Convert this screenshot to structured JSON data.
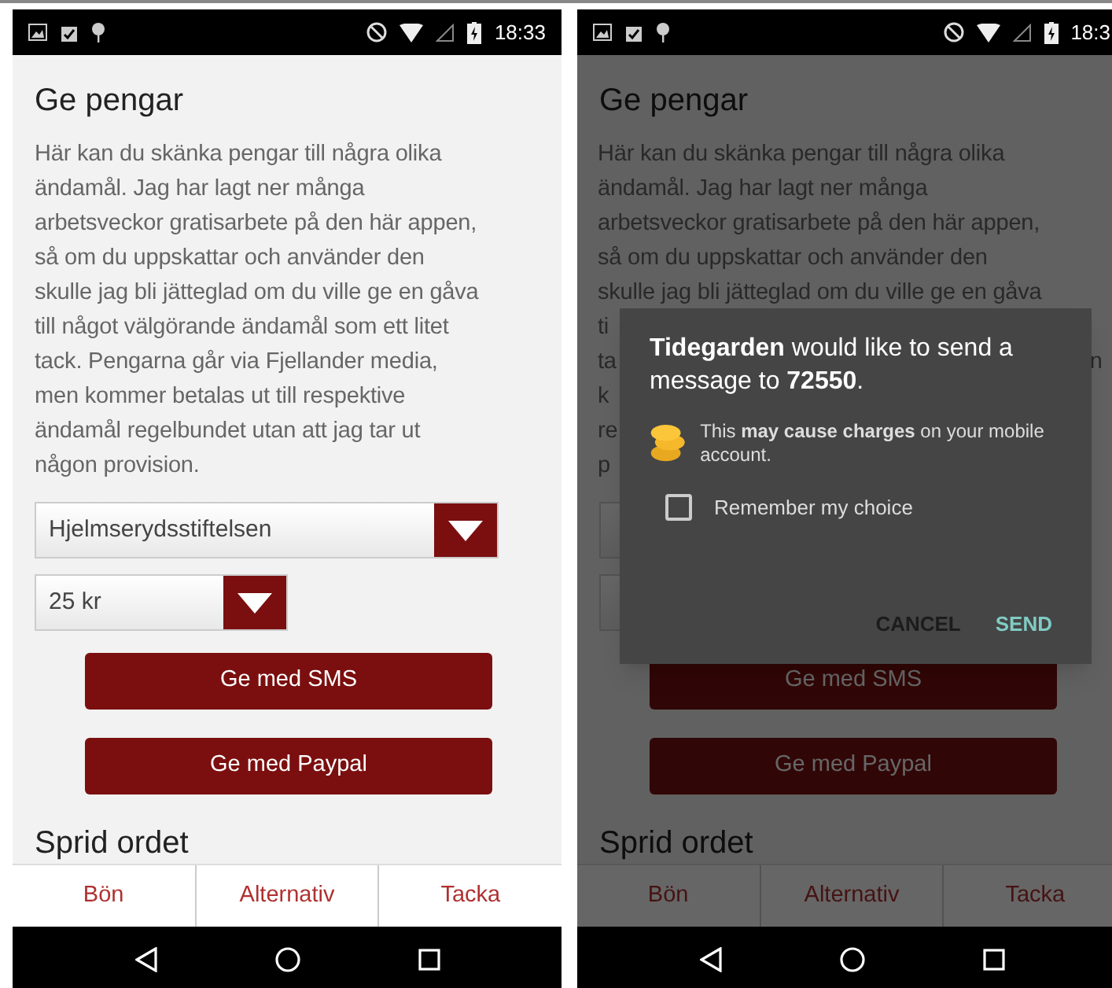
{
  "screens": [
    {
      "status_bar": {
        "time": "18:33"
      },
      "title": "Ge pengar",
      "paragraph": "Här kan du skänka pengar till några olika ändamål. Jag har lagt ner många arbetsveckor gratisarbete på den här appen, så om du uppskattar och använder den skulle jag bli jätteglad om du ville ge en gåva till något välgörande ändamål som ett litet tack. Pengarna går via Fjellander media, men kommer betalas ut till respektive ändamål regelbundet utan att jag tar ut någon provision.",
      "dropdowns": [
        {
          "kind": "wide",
          "value": "Hjelmserydsstiftelsen"
        },
        {
          "kind": "narrow",
          "value": "25 kr"
        }
      ],
      "buttons": [
        "Ge med SMS",
        "Ge med Paypal"
      ],
      "section_title": "Sprid ordet",
      "tabs": [
        "Bön",
        "Alternativ",
        "Tacka"
      ]
    },
    {
      "status_bar": {
        "time": "18:3"
      },
      "title": "Ge pengar",
      "paragraph_lines": [
        {
          "left": "Här kan du skänka pengar till några olika"
        },
        {
          "left": "ändamål. Jag har lagt ner många"
        },
        {
          "left": "arbetsveckor gratisarbete på den här appen,"
        },
        {
          "left": "så om du uppskattar och använder den"
        },
        {
          "left": "skulle jag bli jätteglad om du ville ge en gåva"
        },
        {
          "left": "ti"
        },
        {
          "left": "ta",
          "right": "n"
        },
        {
          "left": "k"
        },
        {
          "left": "re"
        },
        {
          "left": "p"
        }
      ],
      "dropdowns": [
        {
          "kind": "wide"
        },
        {
          "kind": "narrow"
        }
      ],
      "buttons": [
        "Ge med SMS",
        "Ge med Paypal"
      ],
      "section_title": "Sprid ordet",
      "tabs": [
        "Bön",
        "Alternativ",
        "Tacka"
      ],
      "dialog": {
        "message": "**Tidegarden** would like to send a message to **72550**.",
        "warning": "This **may cause charges** on your mobile account.",
        "checkbox": {
          "label": "Remember my choice",
          "checked": false
        },
        "actions": [
          {
            "label": "CANCEL",
            "kind": "secondary"
          },
          {
            "label": "SEND",
            "kind": "primary"
          }
        ]
      }
    }
  ]
}
